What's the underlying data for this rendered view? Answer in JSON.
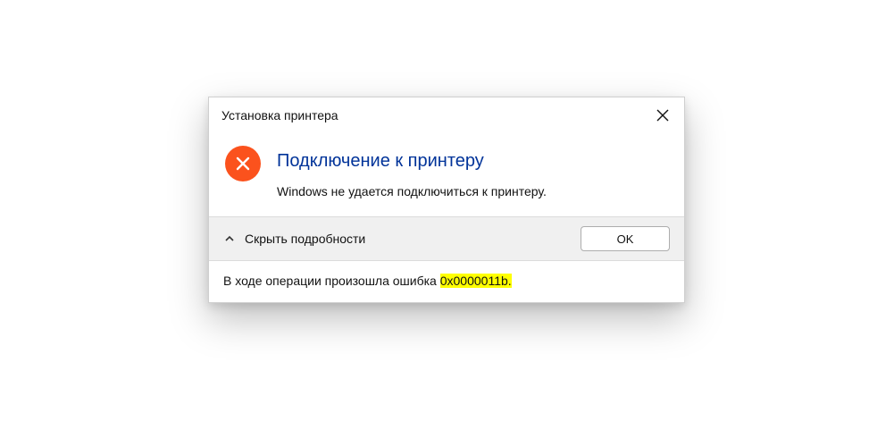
{
  "dialog": {
    "title": "Установка принтера",
    "heading": "Подключение к принтеру",
    "message": "Windows не удается подключиться к принтеру.",
    "toggle_label": "Скрыть подробности",
    "ok_label": "OK",
    "details_prefix": "В ходе операции произошла ошибка ",
    "error_code": "0x0000011b",
    "details_suffix": "."
  },
  "icons": {
    "close": "close-icon",
    "error": "error-x-icon",
    "chevron": "chevron-up-icon"
  },
  "colors": {
    "heading": "#003399",
    "error_badge": "#fb521d",
    "footer_bg": "#f0f0f0",
    "highlight": "#ffff00"
  }
}
